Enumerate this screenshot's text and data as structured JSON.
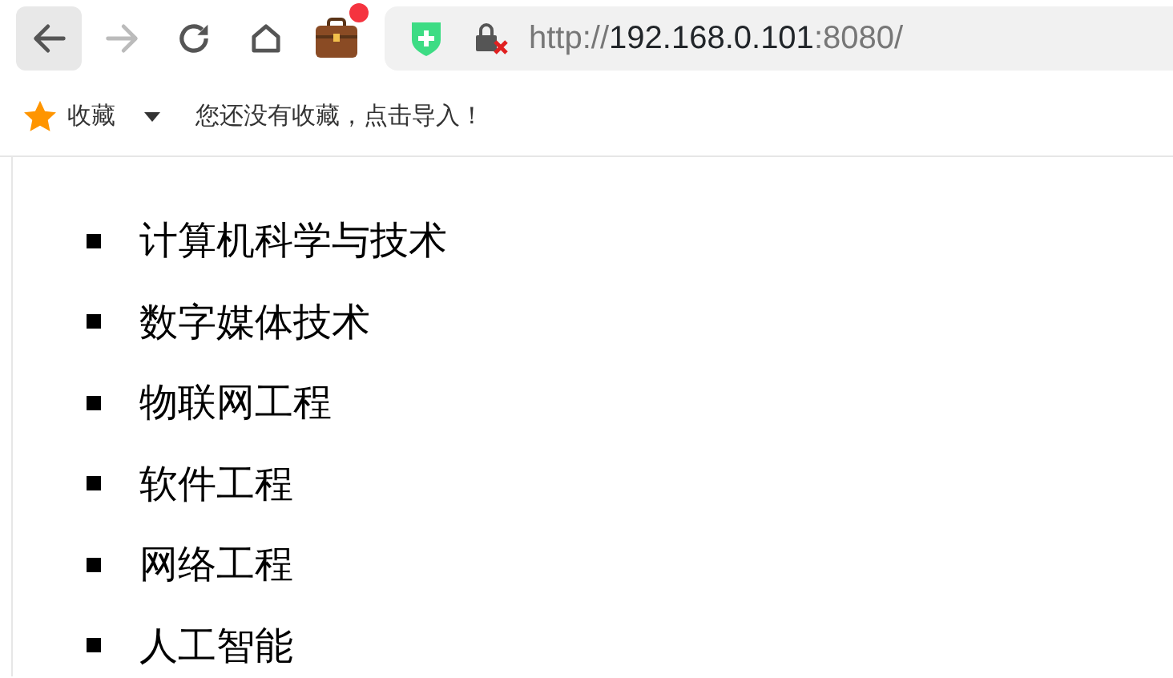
{
  "toolbar": {
    "nav_buttons": [
      {
        "kind": "back",
        "disabled": false,
        "hovered": true
      },
      {
        "kind": "forward",
        "disabled": true,
        "hovered": false
      },
      {
        "kind": "reload",
        "disabled": false,
        "hovered": false
      },
      {
        "kind": "home",
        "disabled": false,
        "hovered": false
      }
    ],
    "extension": {
      "badge": true
    },
    "address": {
      "scheme": "http://",
      "host": "192.168.0.101",
      "rest": ":8080/"
    }
  },
  "bookmarks_bar": {
    "label": "收藏",
    "hint": "您还没有收藏，点击导入！"
  },
  "page": {
    "list": [
      "计算机科学与技术",
      "数字媒体技术",
      "物联网工程",
      "软件工程",
      "网络工程",
      "人工智能"
    ]
  }
}
